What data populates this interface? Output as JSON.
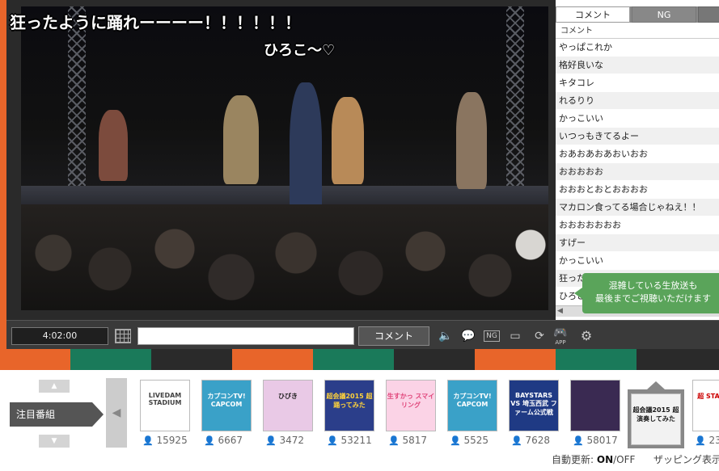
{
  "video": {
    "overlay_main": "狂ったように踊れーーーー！！！！！！",
    "overlay_sub": "ひろこ～♡"
  },
  "controls": {
    "time": "4:02:00",
    "input_placeholder": "",
    "comment_button": "コメント",
    "icons": [
      "volume-icon",
      "comment-bubble-icon",
      "ng-icon",
      "screen-size-icon",
      "reload-icon",
      "gamepad-app-icon",
      "settings-icon"
    ],
    "app_label": "APP"
  },
  "panel": {
    "tab_comment": "コメント",
    "tab_ng": "NG",
    "column_header": "コメント",
    "comments": [
      "やっぱこれか",
      "格好良いな",
      "キタコレ",
      "れるりり",
      "かっこいい",
      "いつっもきてるよー",
      "おあおあおあおいおお",
      "おおおおお",
      "おおおとおとおおおお",
      "マカロン食ってる場合じゃねえ！！",
      "おおおおおおお",
      "すげー",
      "かっこいい",
      "狂ったように踊れーーーー！！",
      "ひろこ～♡"
    ],
    "popup_line1": "混雑している生放送も",
    "popup_line2": "最後までご視聴いただけます"
  },
  "band_colors": [
    "#e8652a",
    "#1a7a5a",
    "#2a2a2a",
    "#e8652a",
    "#1a7a5a",
    "#2a2a2a",
    "#e8652a",
    "#1a7a5a",
    "#2a2a2a"
  ],
  "bottom": {
    "featured_label": "注目番組",
    "programs": [
      {
        "name": "LIVEDAM STADIUM",
        "count": "15925"
      },
      {
        "name": "カプコンTV! CAPCOM",
        "count": "6667"
      },
      {
        "name": "ひびき",
        "count": "3472"
      },
      {
        "name": "超会議2015 超踊ってみた",
        "count": "53211"
      },
      {
        "name": "生すかっ スマイリング",
        "count": "5817"
      },
      {
        "name": "カプコンTV! CAPCOM",
        "count": "5525"
      },
      {
        "name": "BAYSTARS VS 埼玉西武 ファーム公式戦",
        "count": "7628"
      },
      {
        "name": "",
        "count": "58017"
      },
      {
        "name": "超会議2015 超演奏してみた",
        "count": ""
      },
      {
        "name": "超 STA",
        "count": "23"
      }
    ],
    "auto_update_label": "自動更新:",
    "auto_update_on": "ON",
    "auto_update_off": "/OFF",
    "zapping_label": "ザッピング表示"
  }
}
